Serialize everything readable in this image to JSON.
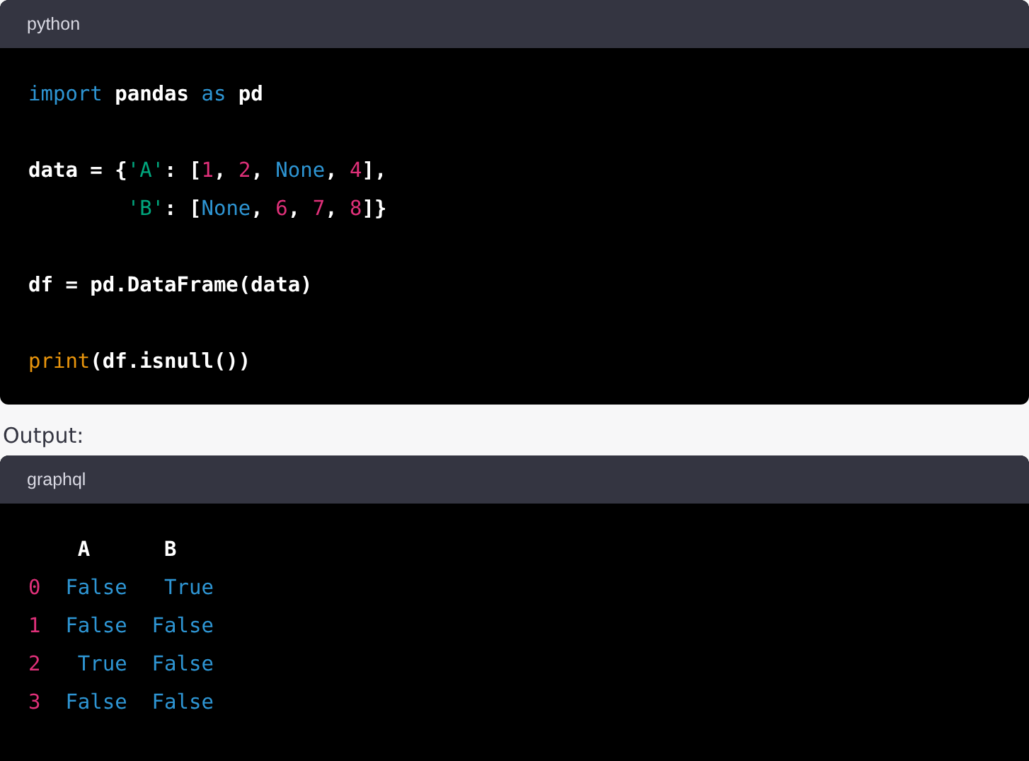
{
  "blocks": [
    {
      "language": "python",
      "groups": [
        [
          {
            "tokens": [
              {
                "text": "import",
                "kind": "keyword"
              },
              {
                "text": " pandas ",
                "kind": "plain"
              },
              {
                "text": "as",
                "kind": "keyword"
              },
              {
                "text": " pd",
                "kind": "plain"
              }
            ]
          }
        ],
        [
          {
            "tokens": [
              {
                "text": "data = {",
                "kind": "plain"
              },
              {
                "text": "'A'",
                "kind": "string"
              },
              {
                "text": ": [",
                "kind": "plain"
              },
              {
                "text": "1",
                "kind": "number"
              },
              {
                "text": ", ",
                "kind": "plain"
              },
              {
                "text": "2",
                "kind": "number"
              },
              {
                "text": ", ",
                "kind": "plain"
              },
              {
                "text": "None",
                "kind": "keyword"
              },
              {
                "text": ", ",
                "kind": "plain"
              },
              {
                "text": "4",
                "kind": "number"
              },
              {
                "text": "],",
                "kind": "plain"
              }
            ]
          },
          {
            "tokens": [
              {
                "text": "        'B'",
                "kind": "string"
              },
              {
                "text": ": [",
                "kind": "plain"
              },
              {
                "text": "None",
                "kind": "keyword"
              },
              {
                "text": ", ",
                "kind": "plain"
              },
              {
                "text": "6",
                "kind": "number"
              },
              {
                "text": ", ",
                "kind": "plain"
              },
              {
                "text": "7",
                "kind": "number"
              },
              {
                "text": ", ",
                "kind": "plain"
              },
              {
                "text": "8",
                "kind": "number"
              },
              {
                "text": "]}",
                "kind": "plain"
              }
            ]
          }
        ],
        [
          {
            "tokens": [
              {
                "text": "df = pd.DataFrame(data)",
                "kind": "plain"
              }
            ]
          }
        ],
        [
          {
            "tokens": [
              {
                "text": "print",
                "kind": "builtin"
              },
              {
                "text": "(df.isnull())",
                "kind": "plain"
              }
            ]
          }
        ]
      ]
    },
    {
      "caption": "Output:",
      "language": "graphql",
      "groups": [
        [
          {
            "tokens": [
              {
                "text": "    A      B",
                "kind": "plain"
              }
            ]
          },
          {
            "tokens": [
              {
                "text": "0",
                "kind": "number"
              },
              {
                "text": "  False   True",
                "kind": "keyword"
              }
            ]
          },
          {
            "tokens": [
              {
                "text": "1",
                "kind": "number"
              },
              {
                "text": "  False  False",
                "kind": "keyword"
              }
            ]
          },
          {
            "tokens": [
              {
                "text": "2",
                "kind": "number"
              },
              {
                "text": "   True  False",
                "kind": "keyword"
              }
            ]
          },
          {
            "tokens": [
              {
                "text": "3",
                "kind": "number"
              },
              {
                "text": "  False  False",
                "kind": "keyword"
              }
            ]
          }
        ]
      ]
    }
  ]
}
